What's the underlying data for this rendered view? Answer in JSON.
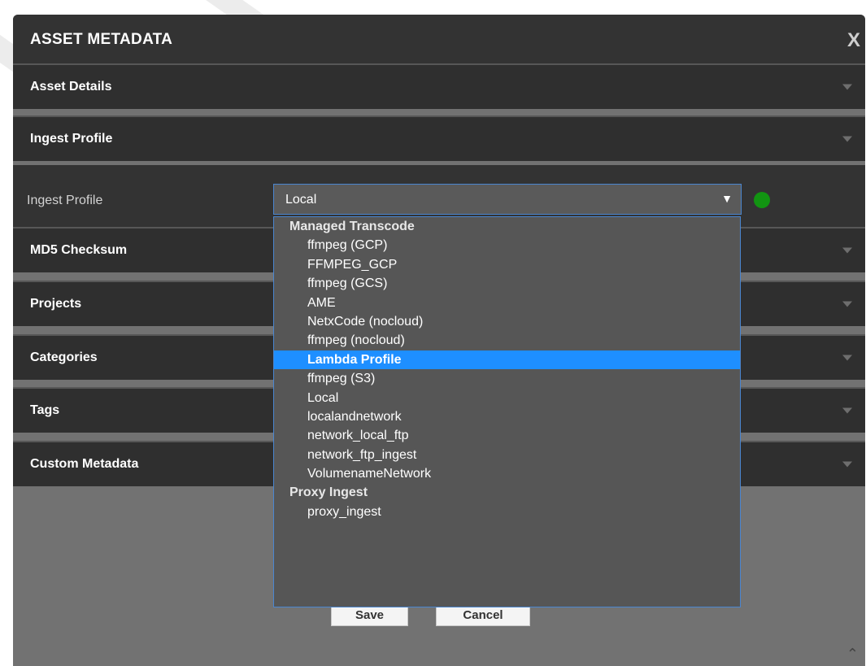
{
  "modal": {
    "title": "ASSET METADATA",
    "close_label": "X"
  },
  "sections": [
    {
      "label": "Asset Details"
    },
    {
      "label": "Ingest Profile"
    },
    {
      "label": "MD5 Checksum"
    },
    {
      "label": "Projects"
    },
    {
      "label": "Categories"
    },
    {
      "label": "Tags"
    },
    {
      "label": "Custom Metadata"
    }
  ],
  "ingest": {
    "field_label": "Ingest Profile",
    "selected_value": "Local",
    "arrow": "▼",
    "status_color": "#129412"
  },
  "dropdown": {
    "groups": [
      {
        "label": "Managed Transcode",
        "options": [
          "ffmpeg (GCP)",
          "FFMPEG_GCP",
          "ffmpeg (GCS)",
          "AME",
          "NetxCode (nocloud)",
          "ffmpeg (nocloud)",
          "Lambda Profile",
          "ffmpeg (S3)",
          "Local",
          "localandnetwork",
          "network_local_ftp",
          "network_ftp_ingest",
          "VolumenameNetwork"
        ]
      },
      {
        "label": "Proxy Ingest",
        "options": [
          "proxy_ingest"
        ]
      }
    ],
    "highlighted": "Lambda Profile",
    "highlight_color": "#1e8fff"
  },
  "buttons": {
    "save_label": "Save",
    "cancel_label": "Cancel"
  },
  "scroll_up_icon": "chevron-up-icon"
}
